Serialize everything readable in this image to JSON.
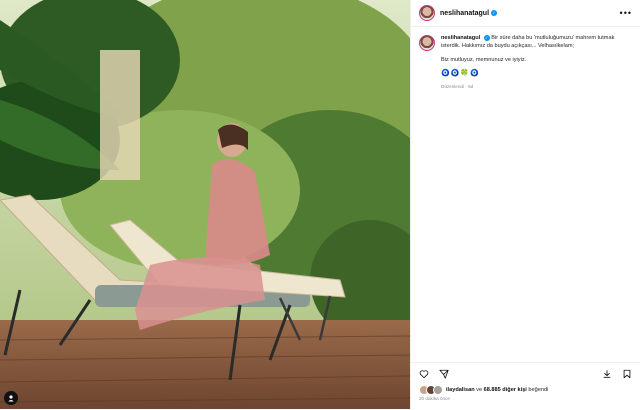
{
  "photo": {
    "alt_icon": "user-tag-icon"
  },
  "post": {
    "username": "neslihanatagul",
    "more_label": "•••",
    "caption_line1": "Bir süre daha bu 'mutluluğumuzu' mahrem tutmak isterdik. Hakkımız da buydu açıkçası... Velhasılkelam;",
    "caption_line2": "Biz mutluyuz, memnunuz ve iyiyiz.",
    "emojis": "🧿🧿🍀🧿",
    "edited": "Düzenlendi · 5d"
  },
  "actions": {
    "like_icon": "heart-icon",
    "share_icon": "paper-plane-icon",
    "save_icon": "bookmark-icon",
    "download_icon": "download-icon"
  },
  "likes": {
    "first_liker": "ilaydalisan",
    "rest": " ve 68.885 diğer kişi beğendi",
    "rest_bold": "68.885 diğer kişi",
    "time_ago": "20 dakika önce"
  },
  "colors": {
    "accent": "#0095f6",
    "story_ring": "#c13584"
  }
}
